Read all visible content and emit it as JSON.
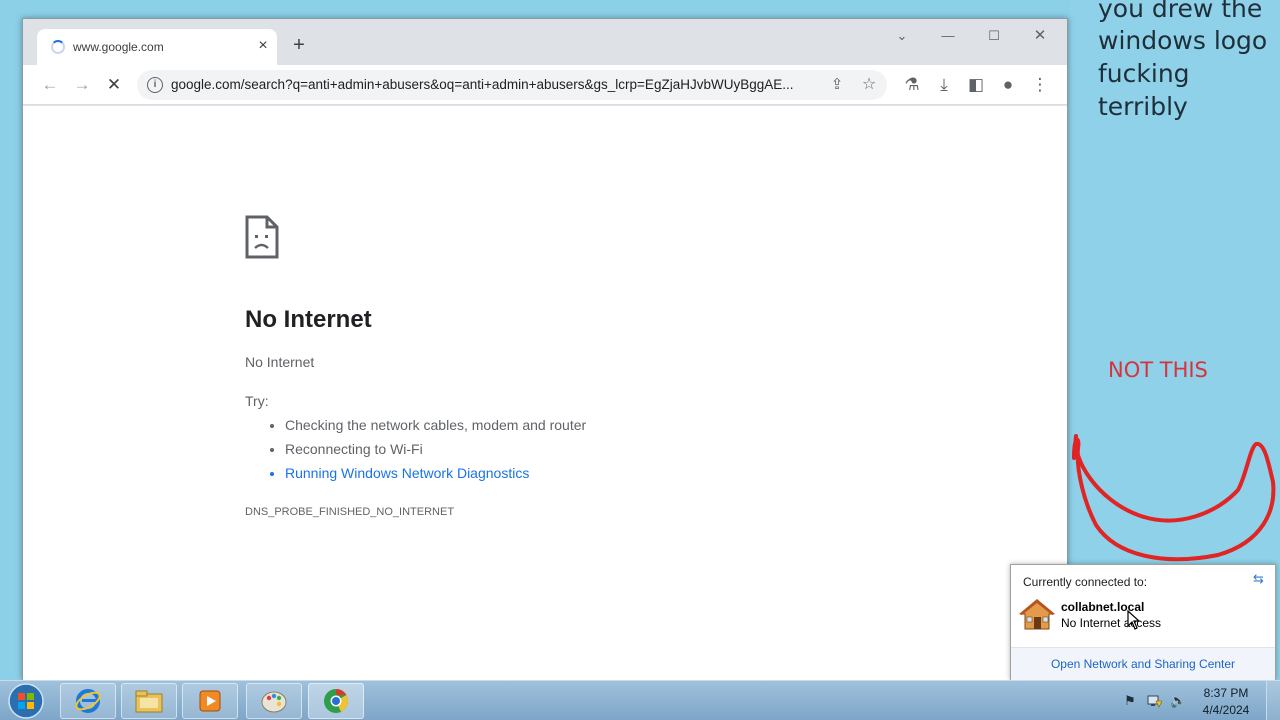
{
  "paint_canvas": {
    "lines": [
      "you drew the",
      "windows logo",
      "fucking terribly"
    ],
    "not_this": "NOT THIS",
    "scribble_color": "#e12424"
  },
  "browser": {
    "tab_title": "www.google.com",
    "tab_close": "×",
    "new_tab": "+",
    "window_controls": {
      "tab_search": "⌄",
      "minimize": "—",
      "maximize": "☐",
      "close": "✕"
    },
    "nav": {
      "back": "←",
      "forward": "→",
      "stop": "✕"
    },
    "url": "google.com/search?q=anti+admin+abusers&oq=anti+admin+abusers&gs_lcrp=EgZjaHJvbWUyBggAE...",
    "info_icon": "i",
    "share_icon": "⇪",
    "bookmark_icon": "☆",
    "toolbar_icons": {
      "labs": "⚗",
      "download": "⤓",
      "side_panel": "◧",
      "profile": "●",
      "menu": "⋮"
    }
  },
  "error_page": {
    "heading": "No Internet",
    "subheading": "No Internet",
    "try_label": "Try:",
    "suggestions": [
      "Checking the network cables, modem and router",
      "Reconnecting to Wi-Fi",
      "Running Windows Network Diagnostics"
    ],
    "error_code": "DNS_PROBE_FINISHED_NO_INTERNET"
  },
  "network_popup": {
    "header": "Currently connected to:",
    "refresh_icon": "⇆",
    "network_name": "collabnet.local",
    "network_status": "No Internet access",
    "footer_link": "Open Network and Sharing Center"
  },
  "taskbar": {
    "apps": [
      "internet-explorer",
      "windows-explorer",
      "media-player",
      "paint",
      "chrome"
    ],
    "tray": {
      "flag": "⚑",
      "network": "▮",
      "volume": "🔈"
    },
    "clock_time": "8:37 PM",
    "clock_date": "4/4/2024"
  },
  "colors": {
    "link_blue": "#1a73e8",
    "paint_bg": "#8ed1e9",
    "not_this_red": "#d8333b"
  }
}
